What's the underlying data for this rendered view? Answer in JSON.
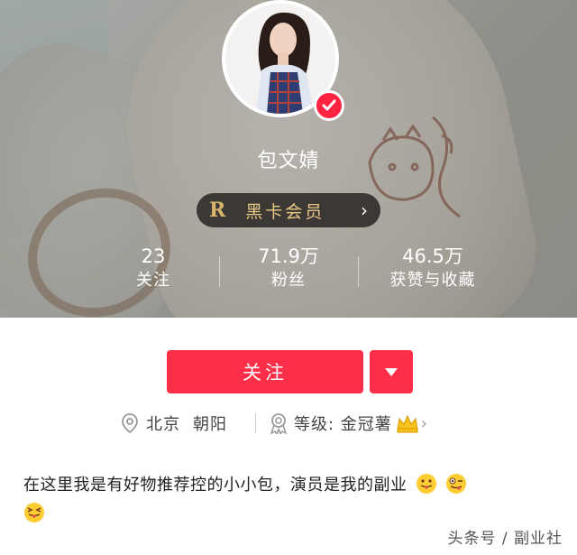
{
  "profile": {
    "name": "包文婧",
    "vip_badge": {
      "letter": "R",
      "label": "黑卡会员"
    }
  },
  "stats": [
    {
      "value": "23",
      "label": "关注"
    },
    {
      "value": "71.9万",
      "label": "粉丝"
    },
    {
      "value": "46.5万",
      "label": "获赞与收藏"
    }
  ],
  "actions": {
    "follow_label": "关注"
  },
  "meta": {
    "city": "北京",
    "district": "朝阳",
    "level_label": "等级: 金冠薯"
  },
  "bio": {
    "text": "在这里我是有好物推荐控的小小包，演员是我的副业"
  },
  "watermark": "头条号 / 副业社",
  "colors": {
    "accent": "#ff2f4a",
    "vip_gold": "#e9c987",
    "vip_bg": "#28241f"
  },
  "icons": [
    "verified-badge-icon",
    "chevron-right-icon",
    "dropdown-caret-icon",
    "location-pin-icon",
    "level-badge-icon",
    "crown-icon",
    "tongue-wink-emoji",
    "crazy-face-emoji",
    "squint-tongue-emoji"
  ]
}
